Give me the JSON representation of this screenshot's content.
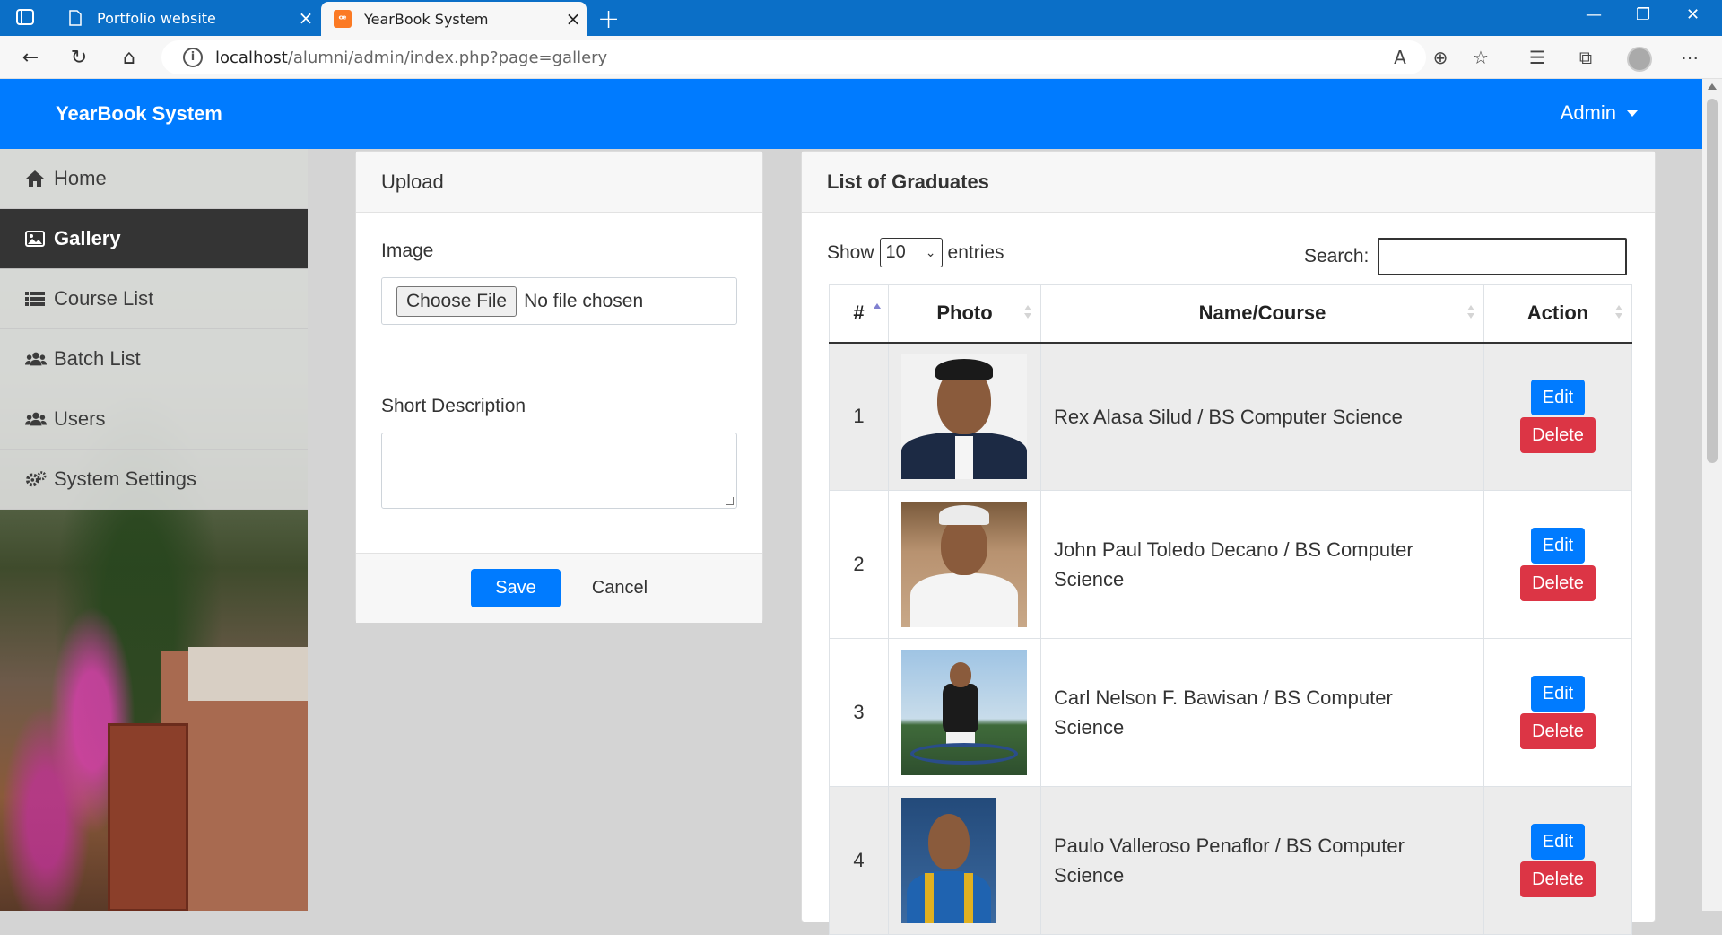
{
  "browser": {
    "tabs": [
      {
        "title": "Portfolio website"
      },
      {
        "title": "YearBook System"
      }
    ],
    "url_host": "localhost",
    "url_path": "/alumni/admin/index.php?page=gallery"
  },
  "navbar": {
    "brand": "YearBook System",
    "user": "Admin"
  },
  "sidebar": {
    "items": [
      {
        "label": "Home",
        "icon": "home-icon"
      },
      {
        "label": "Gallery",
        "icon": "image-icon",
        "active": true
      },
      {
        "label": "Course List",
        "icon": "list-icon"
      },
      {
        "label": "Batch List",
        "icon": "users-icon"
      },
      {
        "label": "Users",
        "icon": "users-icon"
      },
      {
        "label": "System Settings",
        "icon": "gears-icon"
      }
    ]
  },
  "upload": {
    "title": "Upload",
    "image_label": "Image",
    "choose_file": "Choose File",
    "no_file": "No file chosen",
    "desc_label": "Short Description",
    "save": "Save",
    "cancel": "Cancel"
  },
  "graduates": {
    "title": "List of Graduates",
    "show": "Show",
    "entries_value": "10",
    "entries": "entries",
    "search_label": "Search:",
    "columns": [
      "#",
      "Photo",
      "Name/Course",
      "Action"
    ],
    "rows": [
      {
        "num": "1",
        "name": "Rex Alasa Silud / BS Computer Science"
      },
      {
        "num": "2",
        "name": "John Paul Toledo Decano / BS Computer Science"
      },
      {
        "num": "3",
        "name": "Carl Nelson F. Bawisan / BS Computer Science"
      },
      {
        "num": "4",
        "name": "Paulo Valleroso Penaflor / BS Computer Science"
      }
    ],
    "edit": "Edit",
    "delete": "Delete"
  },
  "colors": {
    "primary": "#007bff",
    "danger": "#dc3545",
    "browser_blue": "#0b6fc7"
  }
}
